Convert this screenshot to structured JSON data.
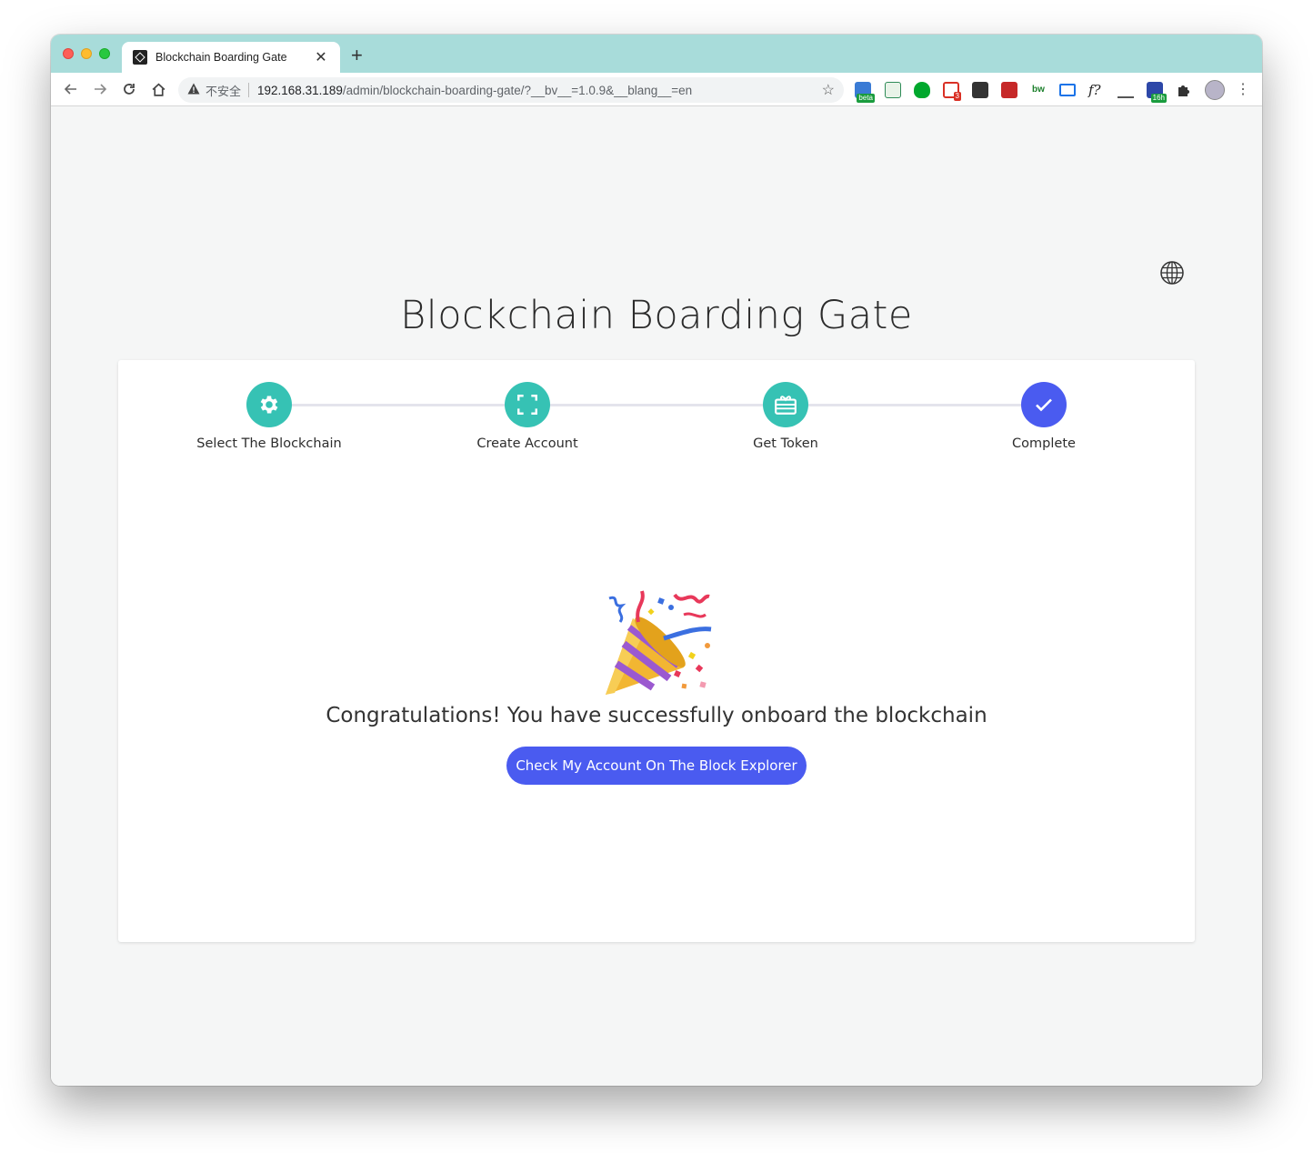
{
  "browser": {
    "tab_title": "Blockchain Boarding Gate",
    "tab_close": "✕",
    "new_tab": "+",
    "security_label": "不安全",
    "url_host": "192.168.31.189",
    "url_path": "/admin/blockchain-boarding-gate/?__bv__=1.0.9&__blang__=en",
    "extensions": [
      {
        "name": "beta-extension-icon",
        "badge": "beta"
      },
      {
        "name": "sheet-extension-icon"
      },
      {
        "name": "evernote-extension-icon"
      },
      {
        "name": "gmail-extension-icon",
        "badge": "3"
      },
      {
        "name": "new-extension-icon"
      },
      {
        "name": "red-extension-icon"
      },
      {
        "name": "bw-extension-icon"
      },
      {
        "name": "screen-extension-icon"
      },
      {
        "name": "fx-extension-icon"
      },
      {
        "name": "ens-extension-icon"
      },
      {
        "name": "timer-extension-icon",
        "badge": "16h"
      },
      {
        "name": "puzzle-extension-icon"
      }
    ]
  },
  "page": {
    "title": "Blockchain Boarding Gate",
    "steps": [
      {
        "label": "Select The Blockchain",
        "icon": "gear-icon",
        "color": "#36c2b4"
      },
      {
        "label": "Create Account",
        "icon": "scan-icon",
        "color": "#36c2b4"
      },
      {
        "label": "Get Token",
        "icon": "gift-card-icon",
        "color": "#36c2b4"
      },
      {
        "label": "Complete",
        "icon": "check-icon",
        "color": "#4a5bf0"
      }
    ],
    "message": "Congratulations! You have successfully onboard the blockchain",
    "button_label": "Check My Account On The Block Explorer",
    "accent_color": "#4a5bf0"
  }
}
